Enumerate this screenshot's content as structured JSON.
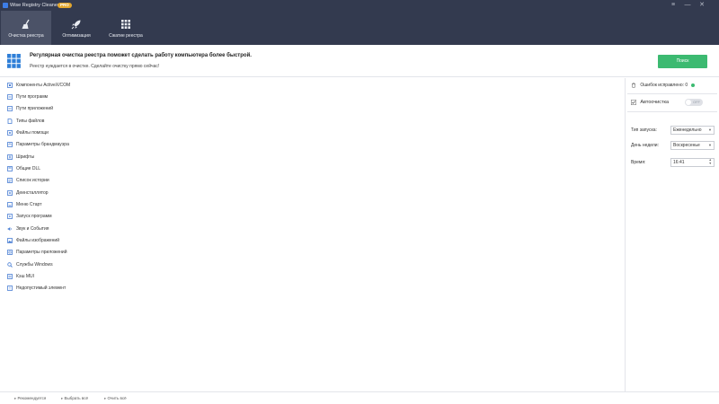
{
  "app": {
    "title": "Wise Registry Cleaner 11",
    "badge": "PRO"
  },
  "window_controls": {
    "menu": "≡",
    "minimize": "—",
    "close": "✕"
  },
  "tabs": [
    {
      "label": "Очистка реестра",
      "icon": "broom-icon",
      "active": true
    },
    {
      "label": "Оптимизация",
      "icon": "rocket-icon",
      "active": false
    },
    {
      "label": "Сжатие реестра",
      "icon": "grid-icon",
      "active": false
    }
  ],
  "banner": {
    "title": "Регулярная очистка реестра поможет сделать работу компьютера более быстрой.",
    "subtitle": "Реестр нуждается в очистке. Сделайте очистку прямо сейчас!",
    "scan_button": "Поиск"
  },
  "items": [
    {
      "label": "Компоненты ActiveX/COM",
      "icon": "component-icon"
    },
    {
      "label": "Пути программ",
      "icon": "path-icon"
    },
    {
      "label": "Пути приложений",
      "icon": "path-icon"
    },
    {
      "label": "Типы файлов",
      "icon": "file-type-icon"
    },
    {
      "label": "Файлы помощи",
      "icon": "help-file-icon"
    },
    {
      "label": "Параметры брандмауэра",
      "icon": "firewall-icon"
    },
    {
      "label": "Шрифты",
      "icon": "font-icon"
    },
    {
      "label": "Общие DLL",
      "icon": "dll-icon"
    },
    {
      "label": "Список истории",
      "icon": "history-icon"
    },
    {
      "label": "Деинсталлятор",
      "icon": "uninstall-icon"
    },
    {
      "label": "Меню Старт",
      "icon": "start-menu-icon"
    },
    {
      "label": "Запуск программ",
      "icon": "startup-icon"
    },
    {
      "label": "Звук и События",
      "icon": "sound-icon"
    },
    {
      "label": "Файлы изображений",
      "icon": "image-file-icon"
    },
    {
      "label": "Параметры приложений",
      "icon": "app-settings-icon"
    },
    {
      "label": "Службы Windows",
      "icon": "search-icon"
    },
    {
      "label": "Кэш MUI",
      "icon": "cache-icon"
    },
    {
      "label": "Недопустимый элемент",
      "icon": "invalid-icon"
    }
  ],
  "right_panel": {
    "errors_fixed_label": "Ошибок исправлено:",
    "errors_fixed_count": "0",
    "auto_clean_label": "Автоочистка",
    "auto_clean_toggle": "OFF",
    "run_type_label": "Тип запуска:",
    "run_type_value": "Еженедельно",
    "weekday_label": "День недели:",
    "weekday_value": "Воскресенье",
    "time_label": "Время:",
    "time_value": "16:41"
  },
  "footer": {
    "recommended": "Рекомендуется",
    "select_all": "Выбрать всё",
    "clear_all": "Очить всё"
  },
  "colors": {
    "header_bg": "#333a4f",
    "active_tab": "#4b5267",
    "accent_green": "#3cba71",
    "item_icon_blue": "#4a7fd4"
  }
}
